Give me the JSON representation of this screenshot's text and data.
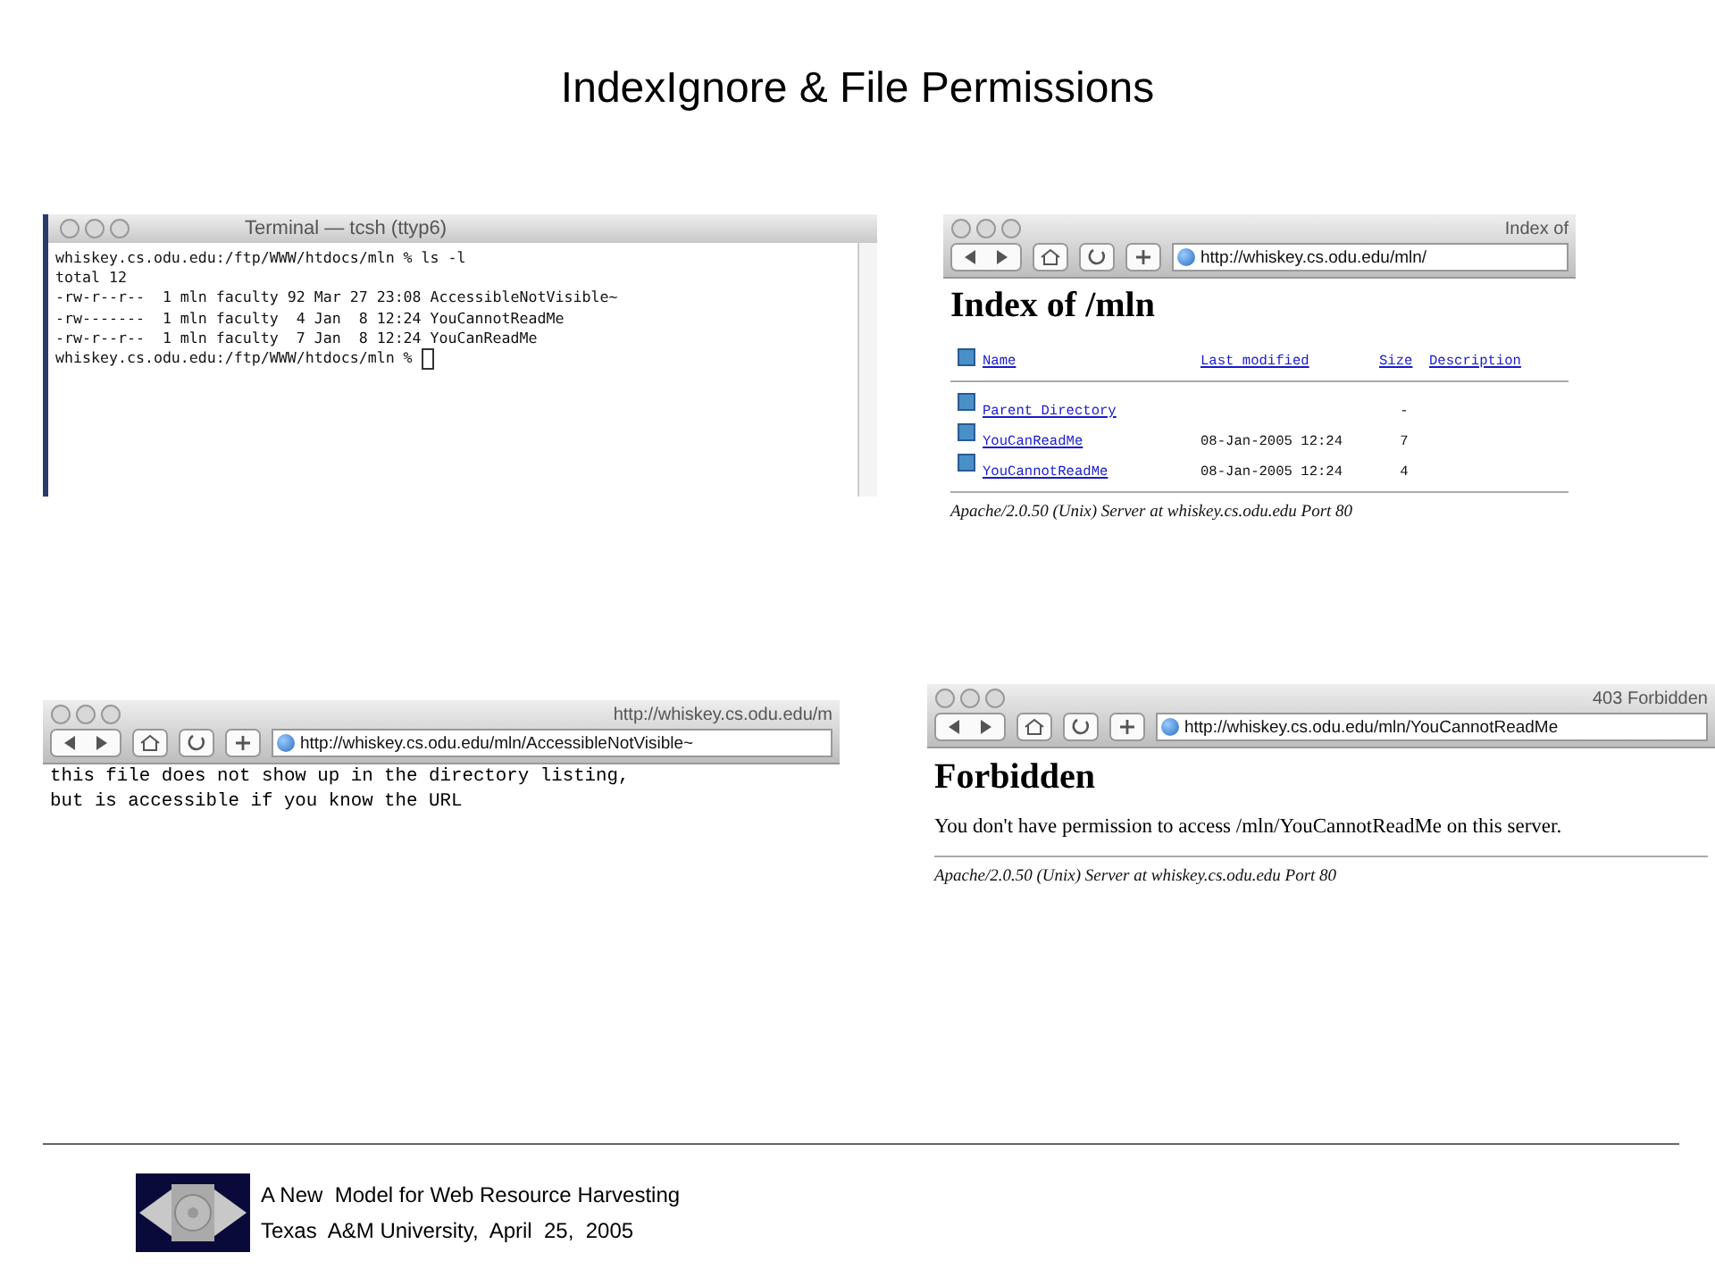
{
  "title": "IndexIgnore & File Permissions",
  "terminal": {
    "title": "Terminal — tcsh (ttyp6)",
    "lines": [
      "whiskey.cs.odu.edu:/ftp/WWW/htdocs/mln % ls -l",
      "total 12",
      "-rw-r--r--  1 mln faculty 92 Mar 27 23:08 AccessibleNotVisible~",
      "-rw-------  1 mln faculty  4 Jan  8 12:24 YouCannotReadMe",
      "-rw-r--r--  1 mln faculty  7 Jan  8 12:24 YouCanReadMe",
      "whiskey.cs.odu.edu:/ftp/WWW/htdocs/mln % "
    ]
  },
  "index_browser": {
    "title": "Index of",
    "url": "http://whiskey.cs.odu.edu/mln/",
    "heading": "Index of /mln",
    "columns": [
      "Name",
      "Last modified",
      "Size",
      "Description"
    ],
    "rows": [
      {
        "name": "Parent Directory",
        "modified": "",
        "size": "-"
      },
      {
        "name": "YouCanReadMe",
        "modified": "08-Jan-2005 12:24",
        "size": "7"
      },
      {
        "name": "YouCannotReadMe",
        "modified": "08-Jan-2005 12:24",
        "size": "4"
      }
    ],
    "footer": "Apache/2.0.50 (Unix) Server at whiskey.cs.odu.edu Port 80"
  },
  "file_browser": {
    "title": "http://whiskey.cs.odu.edu/m",
    "url": "http://whiskey.cs.odu.edu/mln/AccessibleNotVisible~",
    "lines": [
      "this file does not show up in the directory listing,",
      "but is accessible if you know the URL"
    ]
  },
  "forbidden_browser": {
    "title": "403 Forbidden",
    "url": "http://whiskey.cs.odu.edu/mln/YouCannotReadMe",
    "heading": "Forbidden",
    "message": "You don't have permission to access /mln/YouCannotReadMe on this server.",
    "footer": "Apache/2.0.50 (Unix) Server at whiskey.cs.odu.edu Port 80"
  },
  "footer": {
    "lines": [
      "A New  Model for Web Resource Harvesting",
      "Texas  A&M University,  April  25,  2005"
    ]
  }
}
